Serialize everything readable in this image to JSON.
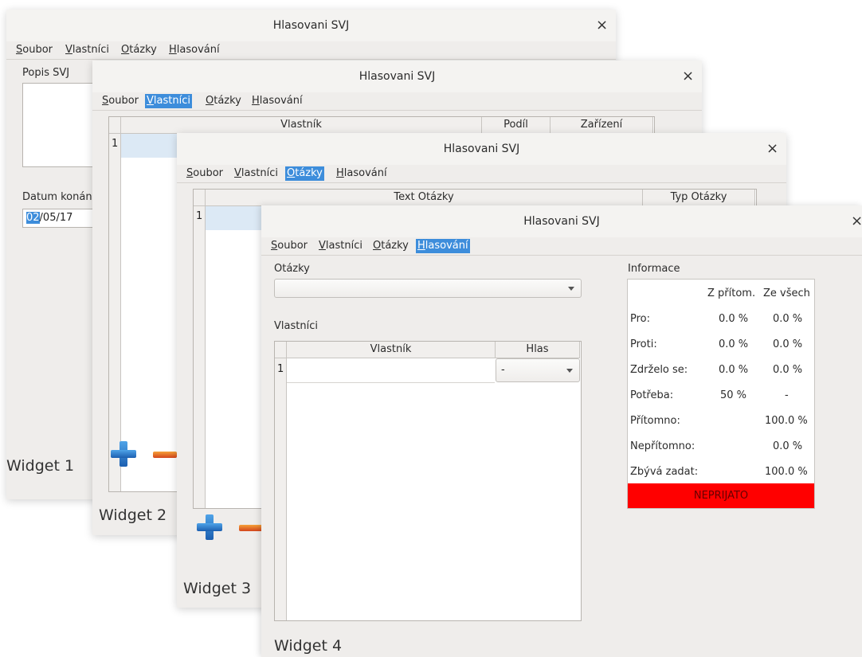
{
  "app_title": "Hlasovani SVJ",
  "close_glyph": "×",
  "menu": {
    "soubor": {
      "u": "S",
      "rest": "oubor"
    },
    "vlastnici": {
      "u": "V",
      "rest": "lastníci"
    },
    "otazky": {
      "u": "O",
      "rest": "tázky"
    },
    "hlasovani": {
      "u": "H",
      "rest": "lasování"
    }
  },
  "w1": {
    "popis_label": "Popis SVJ",
    "datum_label": "Datum konán",
    "date_sel": "02",
    "date_rest": "/05/17",
    "widget_label": "Widget 1"
  },
  "w2": {
    "col_vlastnik": "Vlastník",
    "col_podil": "Podíl",
    "col_zarizeni": "Zařízení",
    "row1": "1",
    "widget_label": "Widget 2"
  },
  "w3": {
    "col_text": "Text Otázky",
    "col_typ": "Typ Otázky",
    "row1": "1",
    "widget_label": "Widget 3"
  },
  "w4": {
    "otazky_label": "Otázky",
    "otazky_value": "",
    "vlastnici_label": "Vlastníci",
    "col_vlastnik": "Vlastník",
    "col_hlas": "Hlas",
    "row1": "1",
    "row1_vlastnik": "",
    "row1_hlas": "-",
    "widget_label": "Widget 4",
    "info": {
      "title": "Informace",
      "col_z_pritom": "Z přítom.",
      "col_ze_vsech": "Ze všech",
      "pro_label": "Pro:",
      "pro_a": "0.0 %",
      "pro_b": "0.0 %",
      "proti_label": "Proti:",
      "proti_a": "0.0 %",
      "proti_b": "0.0 %",
      "zdrzelo_label": "Zdrželo se:",
      "zdrzelo_a": "0.0 %",
      "zdrzelo_b": "0.0 %",
      "potreba_label": "Potřeba:",
      "potreba_a": "50 %",
      "potreba_b": "-",
      "pritomno_label": "Přítomno:",
      "pritomno_b": "100.0 %",
      "nepritomno_label": "Nepřítomno:",
      "nepritomno_b": "0.0 %",
      "zbyva_label": "Zbývá zadat:",
      "zbyva_b": "100.0 %",
      "status": "NEPRIJATO",
      "status_color": "#ff0000"
    }
  },
  "icons": {
    "plus": "plus-icon",
    "minus": "minus-icon"
  }
}
